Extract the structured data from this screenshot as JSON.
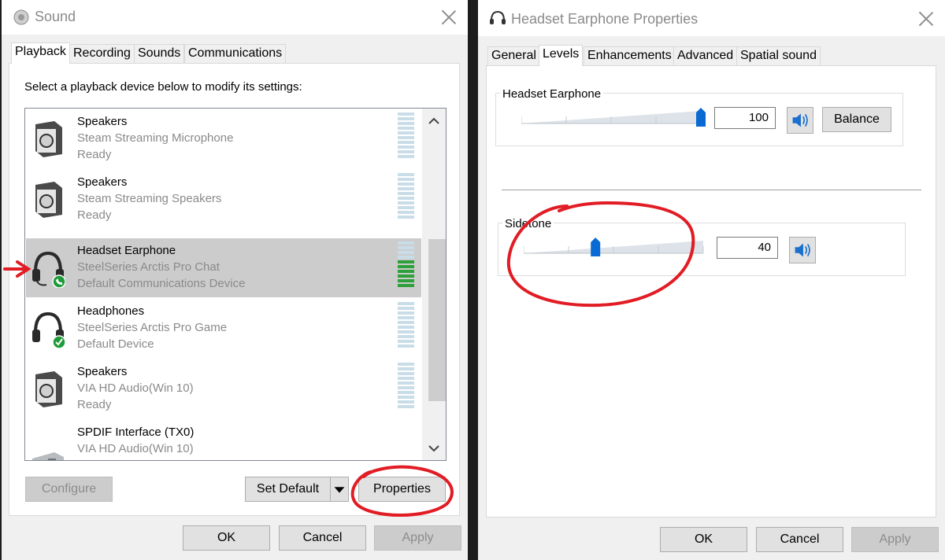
{
  "sound_window": {
    "title": "Sound",
    "tabs": [
      "Playback",
      "Recording",
      "Sounds",
      "Communications"
    ],
    "instruction": "Select a playback device below to modify its settings:",
    "devices": [
      {
        "name": "Speakers",
        "line2": "Steam Streaming Microphone",
        "line3": "Ready",
        "icon": "speaker-icon",
        "selected": false,
        "meter_level": 0
      },
      {
        "name": "Speakers",
        "line2": "Steam Streaming Speakers",
        "line3": "Ready",
        "icon": "speaker-icon",
        "selected": false,
        "meter_level": 0
      },
      {
        "name": "Headset Earphone",
        "line2": "SteelSeries Arctis Pro Chat",
        "line3": "Default Communications Device",
        "icon": "headset-icon",
        "badge": "phone-badge-icon",
        "selected": true,
        "meter_level": 0.6
      },
      {
        "name": "Headphones",
        "line2": "SteelSeries Arctis Pro Game",
        "line3": "Default Device",
        "icon": "headphones-icon",
        "badge": "check-badge-icon",
        "selected": false,
        "meter_level": 0
      },
      {
        "name": "Speakers",
        "line2": "VIA HD Audio(Win 10)",
        "line3": "Ready",
        "icon": "speaker-icon",
        "selected": false,
        "meter_level": 0
      },
      {
        "name": "SPDIF Interface (TX0)",
        "line2": "VIA HD Audio(Win 10)",
        "line3": "",
        "icon": "spdif-icon",
        "selected": false,
        "meter_level": 0
      }
    ],
    "buttons": {
      "configure": "Configure",
      "set_default": "Set Default",
      "properties": "Properties",
      "ok": "OK",
      "cancel": "Cancel",
      "apply": "Apply"
    }
  },
  "properties_window": {
    "title": "Headset Earphone Properties",
    "tabs": [
      "General",
      "Levels",
      "Enhancements",
      "Advanced",
      "Spatial sound"
    ],
    "levels": [
      {
        "label": "Headset Earphone",
        "value": "100",
        "balance_label": "Balance"
      },
      {
        "label": "Sidetone",
        "value": "40"
      }
    ],
    "buttons": {
      "ok": "OK",
      "cancel": "Cancel",
      "apply": "Apply"
    }
  },
  "colors": {
    "annotation_red": "#e11c24",
    "meter_green": "#2ea03a",
    "meter_blue": "#c9dde8",
    "slider_thumb": "#0a6ad4"
  }
}
